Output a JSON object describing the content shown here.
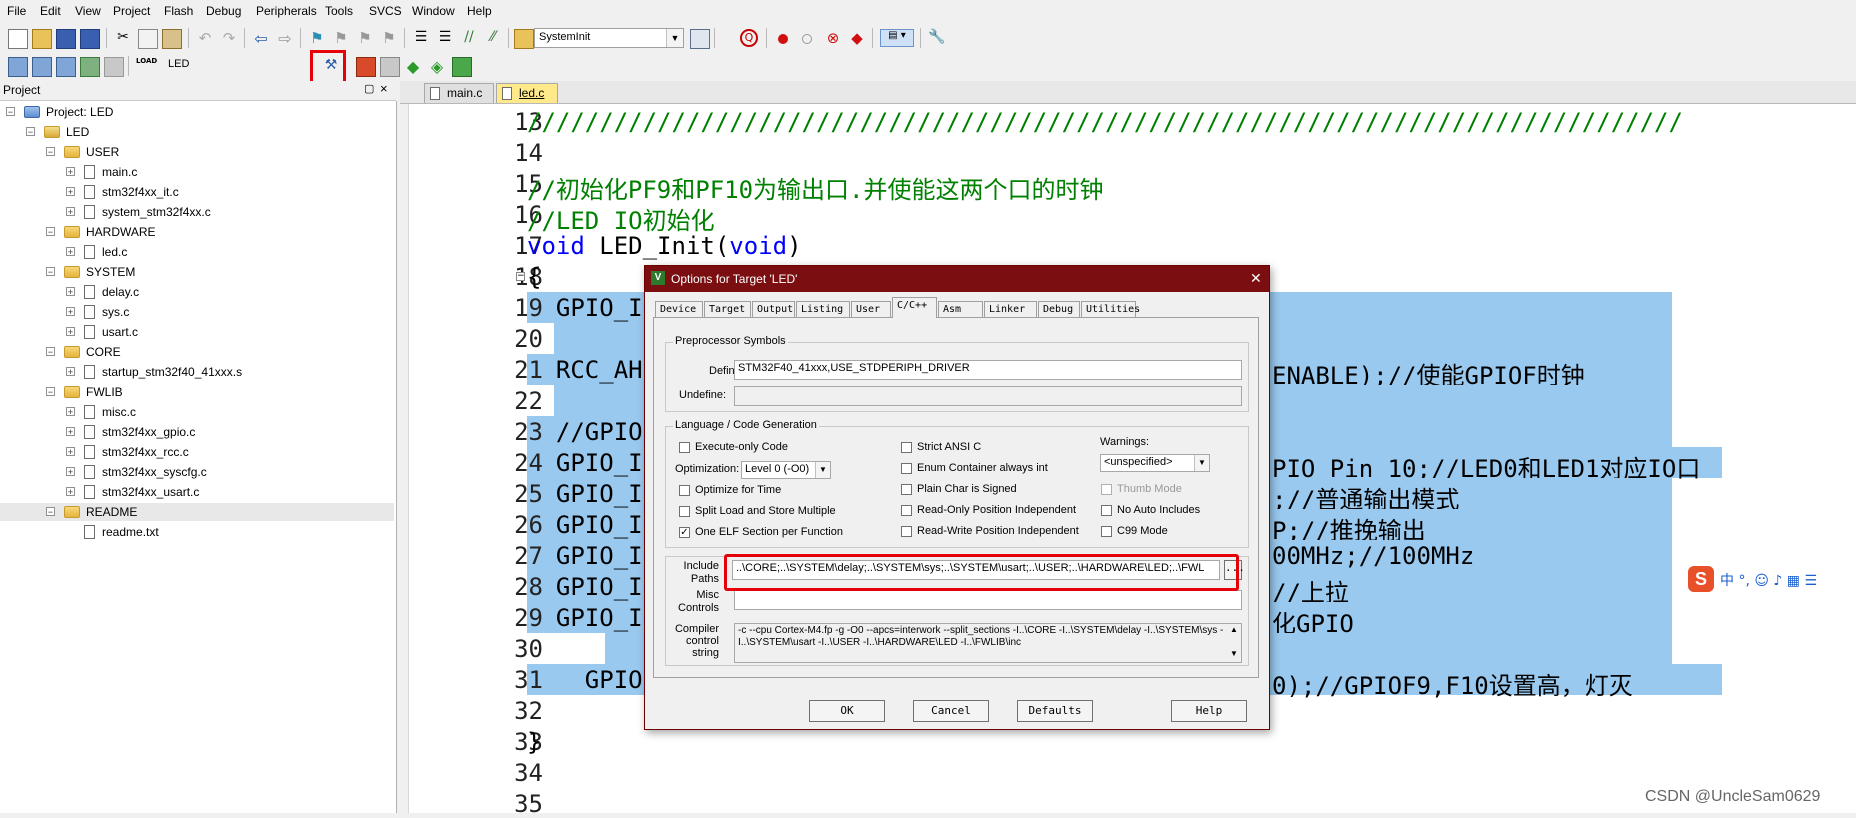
{
  "menu": [
    "File",
    "Edit",
    "View",
    "Project",
    "Flash",
    "Debug",
    "Peripherals",
    "Tools",
    "SVCS",
    "Window",
    "Help"
  ],
  "toolbar": {
    "function_combo": "SystemInit",
    "target_combo": "LED"
  },
  "project_panel": {
    "title": "Project",
    "pin": "▢",
    "close": "×",
    "tree": [
      {
        "label": "Project: LED",
        "level": 0,
        "kind": "project"
      },
      {
        "label": "LED",
        "level": 1,
        "kind": "target"
      },
      {
        "label": "USER",
        "level": 2,
        "kind": "folder"
      },
      {
        "label": "main.c",
        "level": 3,
        "kind": "file"
      },
      {
        "label": "stm32f4xx_it.c",
        "level": 3,
        "kind": "file"
      },
      {
        "label": "system_stm32f4xx.c",
        "level": 3,
        "kind": "file"
      },
      {
        "label": "HARDWARE",
        "level": 2,
        "kind": "folder"
      },
      {
        "label": "led.c",
        "level": 3,
        "kind": "file"
      },
      {
        "label": "SYSTEM",
        "level": 2,
        "kind": "folder"
      },
      {
        "label": "delay.c",
        "level": 3,
        "kind": "file"
      },
      {
        "label": "sys.c",
        "level": 3,
        "kind": "file"
      },
      {
        "label": "usart.c",
        "level": 3,
        "kind": "file"
      },
      {
        "label": "CORE",
        "level": 2,
        "kind": "folder"
      },
      {
        "label": "startup_stm32f40_41xxx.s",
        "level": 3,
        "kind": "file"
      },
      {
        "label": "FWLIB",
        "level": 2,
        "kind": "folder"
      },
      {
        "label": "misc.c",
        "level": 3,
        "kind": "file"
      },
      {
        "label": "stm32f4xx_gpio.c",
        "level": 3,
        "kind": "file"
      },
      {
        "label": "stm32f4xx_rcc.c",
        "level": 3,
        "kind": "file"
      },
      {
        "label": "stm32f4xx_syscfg.c",
        "level": 3,
        "kind": "file"
      },
      {
        "label": "stm32f4xx_usart.c",
        "level": 3,
        "kind": "file"
      },
      {
        "label": "README",
        "level": 2,
        "kind": "folder"
      },
      {
        "label": "readme.txt",
        "level": 3,
        "kind": "file"
      }
    ]
  },
  "editor": {
    "tabs": [
      {
        "label": "main.c",
        "active": false
      },
      {
        "label": "led.c",
        "active": true
      }
    ],
    "lines": [
      {
        "num": "13",
        "text": "////////////////////////////////////////////////////////////////////////////////",
        "style": "cm",
        "sel": false
      },
      {
        "num": "14",
        "text": "",
        "style": "",
        "sel": false
      },
      {
        "num": "15",
        "text": "//初始化PF9和PF10为输出口.并使能这两个口的时钟",
        "style": "cm",
        "sel": false
      },
      {
        "num": "16",
        "text": "//LED IO初始化",
        "style": "cm",
        "sel": false
      },
      {
        "num": "17",
        "text": "void LED_Init(void)",
        "style": "fn",
        "sel": false
      },
      {
        "num": "18",
        "text": "{",
        "style": "",
        "sel": false
      },
      {
        "num": "19",
        "text": "  GPIO_I",
        "style": "",
        "sel": true
      },
      {
        "num": "20",
        "text": "",
        "style": "",
        "sel": true
      },
      {
        "num": "21",
        "text": "  RCC_AH",
        "tail": "ENABLE);//使能GPIOF时钟",
        "style": "",
        "sel": true
      },
      {
        "num": "22",
        "text": "",
        "style": "",
        "sel": true
      },
      {
        "num": "23",
        "text": "  //GPIO",
        "style": "",
        "sel": true
      },
      {
        "num": "24",
        "text": "  GPIO_I",
        "tail": "PIO_Pin_10;//LED0和LED1对应IO口",
        "style": "",
        "sel": true
      },
      {
        "num": "25",
        "text": "  GPIO_I",
        "tail": ";//普通输出模式",
        "style": "",
        "sel": true
      },
      {
        "num": "26",
        "text": "  GPIO_I",
        "tail": "P;//推挽输出",
        "style": "",
        "sel": true
      },
      {
        "num": "27",
        "text": "  GPIO_I",
        "tail": "00MHz;//100MHz",
        "style": "",
        "sel": true
      },
      {
        "num": "28",
        "text": "  GPIO_I",
        "tail": "//上拉",
        "style": "",
        "sel": true
      },
      {
        "num": "29",
        "text": "  GPIO_I",
        "tail": "化GPIO",
        "style": "",
        "sel": true
      },
      {
        "num": "30",
        "text": "",
        "style": "",
        "sel": true
      },
      {
        "num": "31",
        "text": "    GPIO",
        "tail": "0);//GPIOF9,F10设置高，灯灭",
        "style": "",
        "sel": true
      },
      {
        "num": "32",
        "text": "",
        "style": "",
        "sel": false
      },
      {
        "num": "33",
        "text": "}",
        "style": "",
        "sel": false
      },
      {
        "num": "34",
        "text": "",
        "style": "",
        "sel": false
      },
      {
        "num": "35",
        "text": "",
        "style": "",
        "sel": false
      }
    ]
  },
  "dialog": {
    "title": "Options for Target 'LED'",
    "close": "✕",
    "tabs": [
      "Device",
      "Target",
      "Output",
      "Listing",
      "User",
      "C/C++",
      "Asm",
      "Linker",
      "Debug",
      "Utilities"
    ],
    "active_tab": "C/C++",
    "preprocessor": {
      "group": "Preprocessor Symbols",
      "define_label": "Define:",
      "define_value": "STM32F40_41xxx,USE_STDPERIPH_DRIVER",
      "undefine_label": "Undefine:",
      "undefine_value": ""
    },
    "codegen": {
      "group": "Language / Code Generation",
      "execute_only": "Execute-only Code",
      "optimization_label": "Optimization:",
      "optimization_value": "Level 0 (-O0)",
      "optimize_time": "Optimize for Time",
      "split_load": "Split Load and Store Multiple",
      "one_elf": "One ELF Section per Function",
      "strict_ansi": "Strict ANSI C",
      "enum_container": "Enum Container always int",
      "plain_char": "Plain Char is Signed",
      "ro_pi": "Read-Only Position Independent",
      "rw_pi": "Read-Write Position Independent",
      "warnings_label": "Warnings:",
      "warnings_value": "<unspecified>",
      "thumb_mode": "Thumb Mode",
      "no_auto_includes": "No Auto Includes",
      "c99_mode": "C99 Mode"
    },
    "include_label": "Include\nPaths",
    "include_value": "..\\CORE;..\\SYSTEM\\delay;..\\SYSTEM\\sys;..\\SYSTEM\\usart;..\\USER;..\\HARDWARE\\LED;..\\FWL",
    "browse": "...",
    "misc_label": "Misc\nControls",
    "misc_value": "",
    "compiler_label": "Compiler\ncontrol\nstring",
    "compiler_value": "-c --cpu Cortex-M4.fp -g -O0 --apcs=interwork --split_sections -I..\\CORE -I..\\SYSTEM\\delay -I..\\SYSTEM\\sys -I..\\SYSTEM\\usart -I..\\USER -I..\\HARDWARE\\LED -I..\\FWLIB\\inc",
    "buttons": {
      "ok": "OK",
      "cancel": "Cancel",
      "defaults": "Defaults",
      "help": "Help"
    }
  },
  "watermark": "CSDN @UncleSam0629"
}
